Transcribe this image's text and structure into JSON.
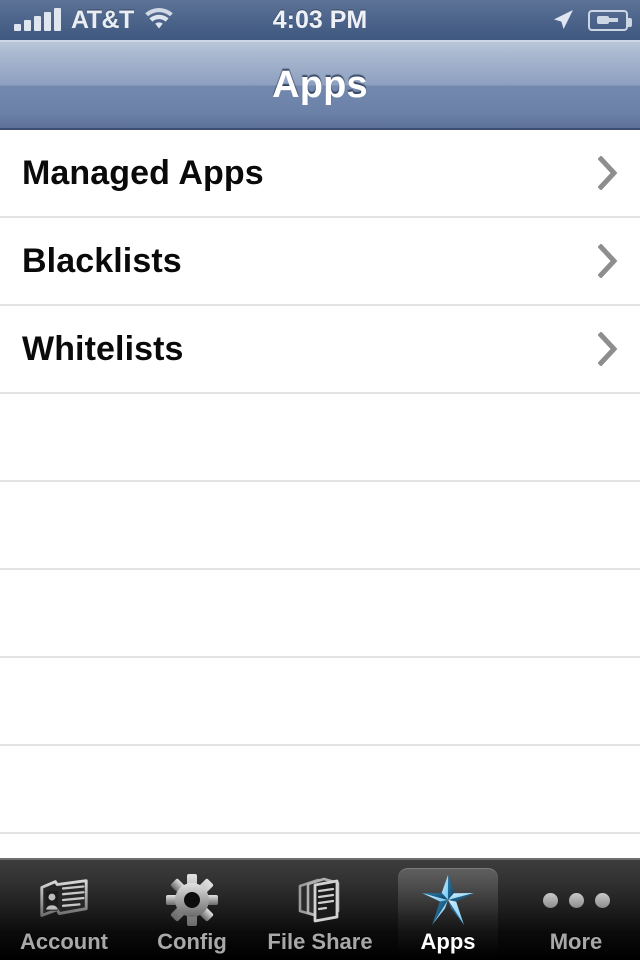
{
  "status_bar": {
    "carrier": "AT&T",
    "clock": "4:03 PM",
    "signal_icon": "signal-bars-icon",
    "signal_bars_filled": 5,
    "wifi_icon": "wifi-icon",
    "location_icon": "location-arrow-icon",
    "battery_icon": "battery-charging-icon",
    "background_color": "#4e668c"
  },
  "nav_bar": {
    "title": "Apps",
    "background_color": "#7489ae"
  },
  "list": {
    "rows": [
      {
        "label": "Managed Apps",
        "accessory_icon": "chevron-right-icon"
      },
      {
        "label": "Blacklists",
        "accessory_icon": "chevron-right-icon"
      },
      {
        "label": "Whitelists",
        "accessory_icon": "chevron-right-icon"
      },
      {
        "label": "",
        "accessory_icon": ""
      },
      {
        "label": "",
        "accessory_icon": ""
      },
      {
        "label": "",
        "accessory_icon": ""
      },
      {
        "label": "",
        "accessory_icon": ""
      },
      {
        "label": "",
        "accessory_icon": ""
      }
    ],
    "separator_color": "#e3e3e3",
    "background_color": "#ffffff"
  },
  "tab_bar": {
    "background_color": "#1d1d1d",
    "selected_index": 3,
    "tabs": [
      {
        "label": "Account",
        "icon": "id-card-person-icon",
        "selected": false
      },
      {
        "label": "Config",
        "icon": "gear-icon",
        "selected": false
      },
      {
        "label": "File Share",
        "icon": "documents-stack-icon",
        "selected": false
      },
      {
        "label": "Apps",
        "icon": "blue-star-icon",
        "selected": true
      },
      {
        "label": "More",
        "icon": "ellipsis-dots-icon",
        "selected": false
      }
    ]
  }
}
